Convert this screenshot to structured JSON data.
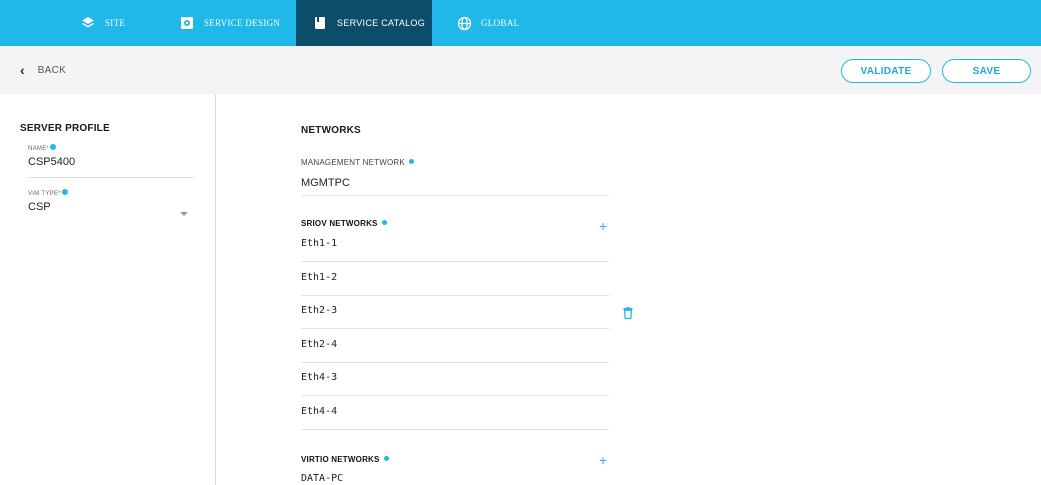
{
  "nav": {
    "tabs": [
      {
        "label": "SITE",
        "icon": "layers-icon"
      },
      {
        "label": "SERVICE DESIGN",
        "icon": "gear-square-icon"
      },
      {
        "label": "SERVICE CATALOG",
        "icon": "book-icon"
      },
      {
        "label": "GLOBAL",
        "icon": "globe-icon"
      }
    ],
    "active_tab": "SERVICE CATALOG"
  },
  "actionbar": {
    "back_label": "BACK",
    "validate_label": "VALIDATE",
    "save_label": "SAVE"
  },
  "server_profile": {
    "title": "SERVER PROFILE",
    "name_label": "NAME*",
    "name_value": "CSP5400",
    "vim_type_label": "VIM TYPE*",
    "vim_type_value": "CSP"
  },
  "networks": {
    "title": "NETWORKS",
    "management_label": "MANAGEMENT NETWORK",
    "management_value": "MGMTPC",
    "sriov_label": "SRIOV NETWORKS",
    "sriov_items": [
      "Eth1-1",
      "Eth1-2",
      "Eth2-3",
      "Eth2-4",
      "Eth4-3",
      "Eth4-4"
    ],
    "virtio_label": "VIRTIO NETWORKS",
    "virtio_items": [
      "DATA-PC"
    ]
  },
  "colors": {
    "accent": "#1fb8e8",
    "active_tab": "#0b4d6b",
    "actionbar_bg": "#f4f4f6"
  }
}
